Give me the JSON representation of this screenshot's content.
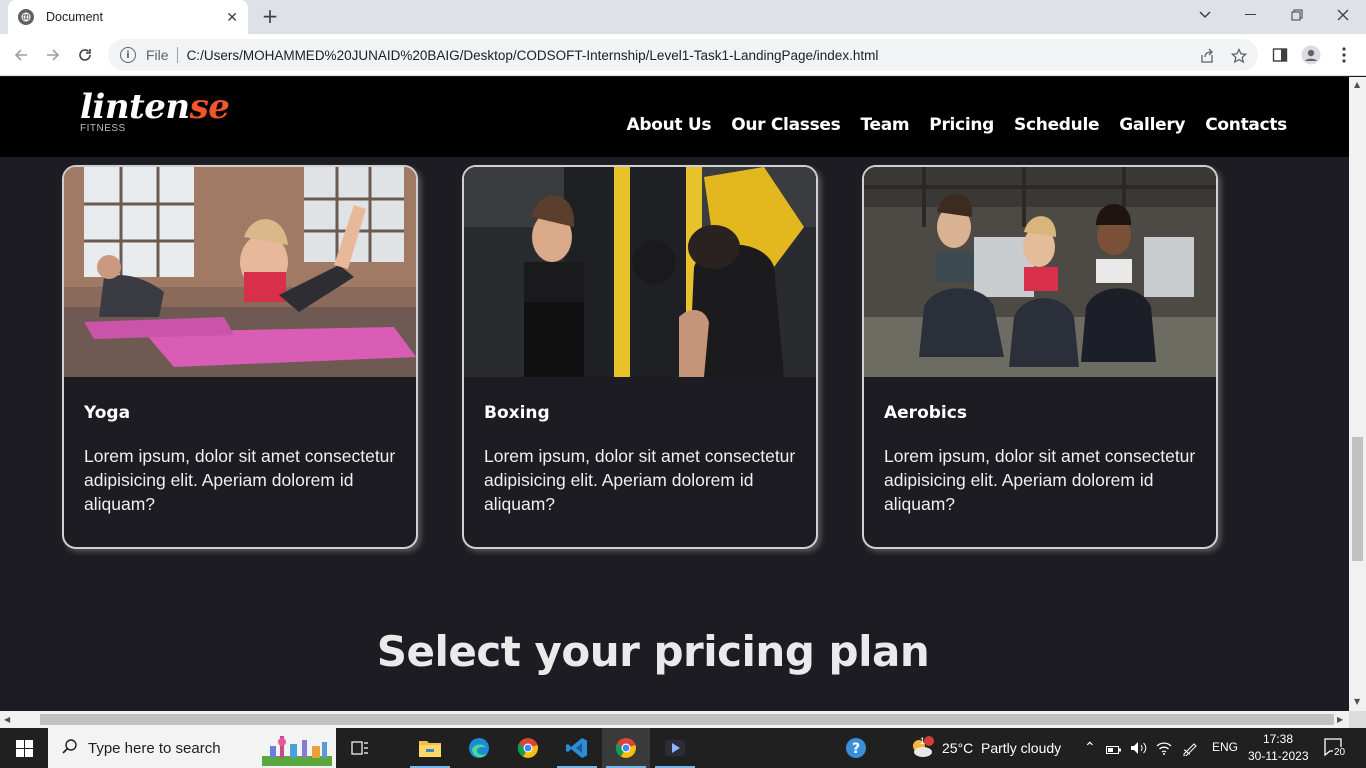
{
  "browser": {
    "tab_title": "Document",
    "tab_close": "✕",
    "new_tab": "+",
    "file_label": "File",
    "url": "C:/Users/MOHAMMED%20JUNAID%20BAIG/Desktop/CODSOFT-Internship/Level1-Task1-LandingPage/index.html"
  },
  "site": {
    "logo_main": "linten",
    "logo_accent": "se",
    "logo_sub": "FITNESS",
    "accent_color": "#f2552c",
    "nav": [
      "About Us",
      "Our Classes",
      "Team",
      "Pricing",
      "Schedule",
      "Gallery",
      "Contacts"
    ]
  },
  "classes": [
    {
      "title": "Yoga",
      "text": "Lorem ipsum, dolor sit amet consectetur adipisicing elit. Aperiam dolorem id aliquam?"
    },
    {
      "title": "Boxing",
      "text": "Lorem ipsum, dolor sit amet consectetur adipisicing elit. Aperiam dolorem id aliquam?"
    },
    {
      "title": "Aerobics",
      "text": "Lorem ipsum, dolor sit amet consectetur adipisicing elit. Aperiam dolorem id aliquam?"
    }
  ],
  "pricing_heading": "Select your pricing plan",
  "taskbar": {
    "search_placeholder": "Type here to search",
    "weather_temp": "25°C",
    "weather_desc": "Partly cloudy",
    "weather_badge": "1",
    "language": "ENG",
    "time": "17:38",
    "date": "30-11-2023",
    "notification_count": "20"
  }
}
